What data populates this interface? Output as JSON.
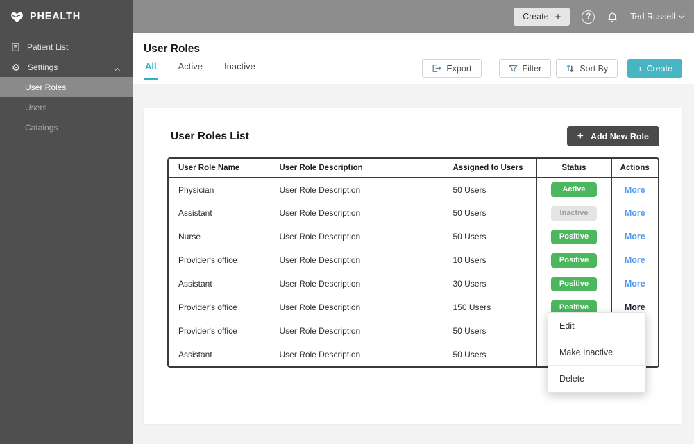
{
  "brand": {
    "name": "PHEALTH"
  },
  "sidebar": {
    "items": [
      {
        "label": "Patient List",
        "icon": "patient-list-icon"
      },
      {
        "label": "Settings",
        "icon": "gear-icon",
        "expanded": true
      }
    ],
    "settings_children": [
      {
        "label": "User Roles",
        "active": true
      },
      {
        "label": "Users",
        "active": false
      },
      {
        "label": "Catalogs",
        "active": false
      }
    ]
  },
  "topbar": {
    "create_label": "Create",
    "create_plus": "+",
    "help_glyph": "?",
    "user_name": "Ted Russell"
  },
  "page": {
    "title": "User Roles",
    "tabs": [
      {
        "label": "All",
        "active": true
      },
      {
        "label": "Active",
        "active": false
      },
      {
        "label": "Inactive",
        "active": false
      }
    ],
    "toolbar": {
      "export_label": "Export",
      "filter_label": "Filter",
      "sort_label": "Sort By",
      "create_label": "Create",
      "create_plus": "+"
    }
  },
  "card": {
    "title": "User Roles List",
    "add_button_label": "Add New Role",
    "add_button_plus": "+",
    "table": {
      "columns": [
        "User Role Name",
        "User Role Description",
        "Assigned to Users",
        "Status",
        "Actions"
      ],
      "rows": [
        {
          "name": "Physician",
          "description": "User Role Description",
          "assigned": "50 Users",
          "status": "Active",
          "status_variant": "green",
          "action": "More",
          "action_active": false
        },
        {
          "name": "Assistant",
          "description": "User Role Description",
          "assigned": "50 Users",
          "status": "Inactive",
          "status_variant": "gray",
          "action": "More",
          "action_active": false
        },
        {
          "name": "Nurse",
          "description": "User Role Description",
          "assigned": "50 Users",
          "status": "Positive",
          "status_variant": "green",
          "action": "More",
          "action_active": false
        },
        {
          "name": "Provider's office",
          "description": "User Role Description",
          "assigned": "10 Users",
          "status": "Positive",
          "status_variant": "green",
          "action": "More",
          "action_active": false
        },
        {
          "name": "Assistant",
          "description": "User Role Description",
          "assigned": "30 Users",
          "status": "Positive",
          "status_variant": "green",
          "action": "More",
          "action_active": false
        },
        {
          "name": "Provider's office",
          "description": "User Role Description",
          "assigned": "150 Users",
          "status": "Positive",
          "status_variant": "green",
          "action": "More",
          "action_active": true
        },
        {
          "name": "Provider's office",
          "description": "User Role Description",
          "assigned": "50 Users",
          "status": null,
          "status_variant": null,
          "action": null,
          "action_active": false
        },
        {
          "name": "Assistant",
          "description": "User Role Description",
          "assigned": "50 Users",
          "status": null,
          "status_variant": null,
          "action": null,
          "action_active": false
        }
      ]
    }
  },
  "context_menu": {
    "items": [
      "Edit",
      "Make Inactive",
      "Delete"
    ]
  },
  "colors": {
    "sidebar_bg": "#4f4f4f",
    "sidebar_active_bg": "#8a8a8a",
    "topbar_bg": "#8d8d8d",
    "accent_teal": "#48b5c3",
    "tab_active_teal": "#2fb0c4",
    "badge_green": "#4cb75f",
    "badge_gray_bg": "#e4e4e4",
    "link_blue": "#4d9cf1",
    "dark_button_bg": "#4a4a4a",
    "table_border": "#3a3a3a"
  }
}
